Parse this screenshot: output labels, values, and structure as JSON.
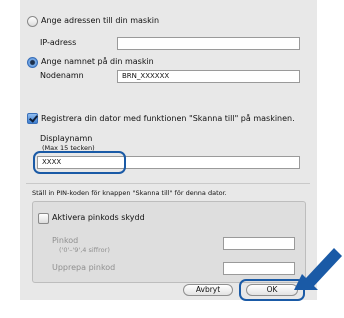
{
  "option_address": {
    "label": "Ange adressen till din maskin",
    "selected": false
  },
  "ip_label": "IP-adress",
  "ip_value": "",
  "option_name": {
    "label": "Ange namnet på din maskin",
    "selected": true
  },
  "node_label": "Nodenamn",
  "node_value": "BRN_XXXXXX",
  "register": {
    "label": "Registrera din dator med funktionen \"Skanna till\" på maskinen.",
    "checked": true
  },
  "display_label_1": "Displaynamn",
  "display_label_2": "(Max 15 tecken)",
  "display_value": "XXXX",
  "pin_intro": "Ställ in PIN-koden för knappen \"Skanna till\" för denna dator.",
  "pin_group": {
    "checkbox_label": "Aktivera pinkods skydd",
    "checked": false,
    "pin_label": "Pinkod",
    "pin_hint": "('0'–'9',4 siffror)",
    "repeat_label": "Upprepa pinkod",
    "pin_value": "",
    "repeat_value": ""
  },
  "buttons": {
    "cancel": "Avbryt",
    "ok": "OK"
  },
  "colors": {
    "highlight": "#1a5aa6",
    "arrow": "#1a5aa6",
    "selection": "#3f7fd0"
  }
}
